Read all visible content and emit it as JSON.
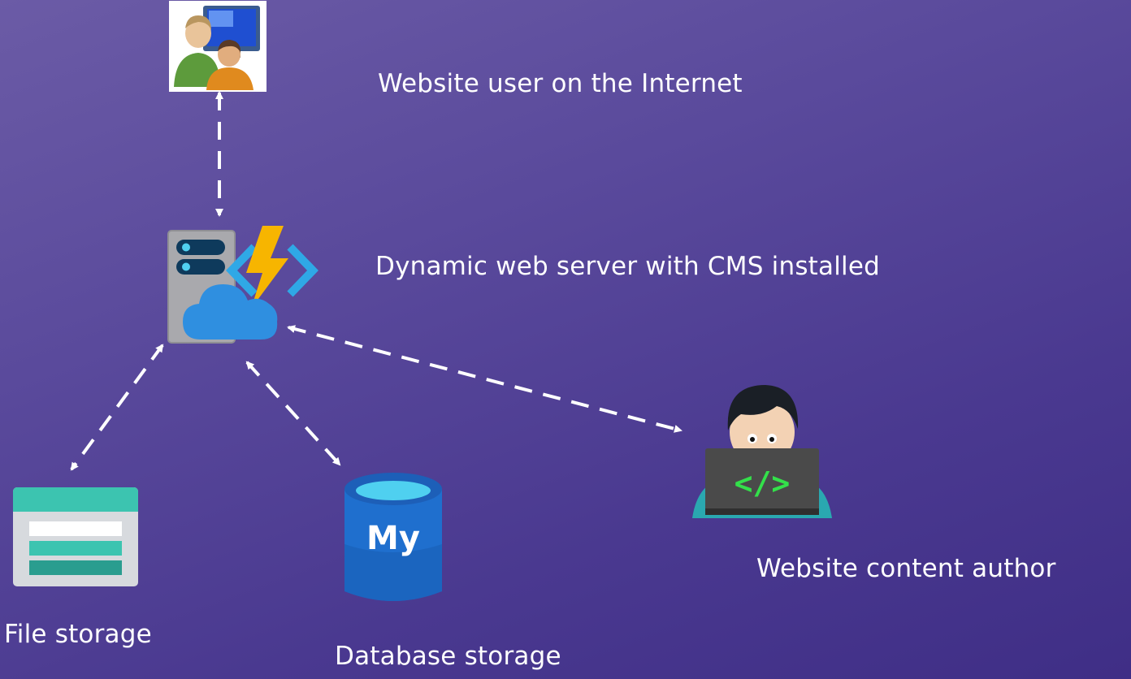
{
  "diagram": {
    "labels": {
      "user": "Website user on the Internet",
      "server": "Dynamic web server with CMS installed",
      "author": "Website content author",
      "file_storage": "File storage",
      "database_storage": "Database storage"
    },
    "database_icon_text": "My",
    "code_icon_text": "</>",
    "connections": [
      {
        "from": "user",
        "to": "server",
        "style": "dashed",
        "arrows": "both"
      },
      {
        "from": "server",
        "to": "file_storage",
        "style": "dashed",
        "arrows": "both"
      },
      {
        "from": "server",
        "to": "database_storage",
        "style": "dashed",
        "arrows": "both"
      },
      {
        "from": "server",
        "to": "author",
        "style": "dashed",
        "arrows": "both"
      }
    ],
    "icons": {
      "user": "users-computer-icon",
      "server": "azure-function-server-icon",
      "author": "developer-laptop-icon",
      "file_storage": "file-storage-icon",
      "database_storage": "mysql-database-icon"
    },
    "colors": {
      "background_top": "#6b5ba6",
      "background_bottom": "#3f2e86",
      "text": "#ffffff",
      "connector": "#ffffff",
      "lightning": "#f7b500",
      "cloud": "#2f8fe0",
      "file_storage_header": "#3cc4b0",
      "database_blue": "#1f6fce",
      "code_green": "#33e04a"
    }
  }
}
